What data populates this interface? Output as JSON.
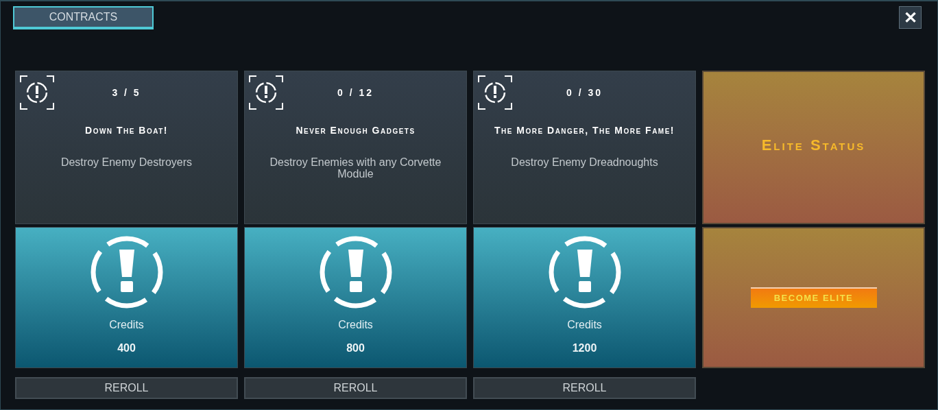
{
  "tabs": [
    {
      "label": "CONTRACTS",
      "selected": true
    }
  ],
  "close": {
    "label": "✕"
  },
  "contracts": [
    {
      "progress": "3 / 5",
      "title": "Down The Boat!",
      "description": "Destroy Enemy Destroyers",
      "reward_label": "Credits",
      "reward": "400",
      "button": "REROLL"
    },
    {
      "progress": "0 / 12",
      "title": "Never Enough Gadgets",
      "description": "Destroy Enemies with any Corvette Module",
      "reward_label": "Credits",
      "reward": "800",
      "button": "REROLL"
    },
    {
      "progress": "0 / 30",
      "title": "The More Danger, The More Fame!",
      "description": "Destroy Enemy Dreadnoughts",
      "reward_label": "Credits",
      "reward": "1200",
      "button": "REROLL"
    }
  ],
  "elite": {
    "title": "Elite Status",
    "button": "BECOME ELITE"
  }
}
